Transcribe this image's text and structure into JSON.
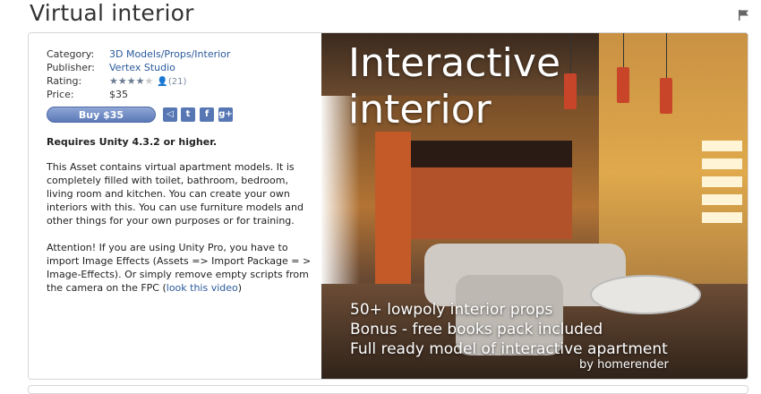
{
  "page": {
    "title": "Virtual interior"
  },
  "meta": {
    "category_label": "Category:",
    "category_value": "3D Models/Props/Interior",
    "publisher_label": "Publisher:",
    "publisher_value": "Vertex Studio",
    "rating_label": "Rating:",
    "rating_stars": 4,
    "rating_max": 5,
    "rating_count": "(21)",
    "price_label": "Price:",
    "price_value": "$35"
  },
  "actions": {
    "buy_label": "Buy $35",
    "share_icons": [
      "share-icon",
      "twitter-icon",
      "facebook-icon",
      "google-plus-icon"
    ]
  },
  "requirements": "Requires Unity 4.3.2 or higher.",
  "description": {
    "para1": "This Asset contains virtual apartment models. It is completely filled with toilet, bathroom, bedroom, living room and kitchen. You can create your own interiors with this. You can use furniture models and other things for your own purposes or for training.",
    "para2_text": "Attention! If you are using Unity Pro, you have to import Image Effects (Assets => Import Package = > Image-Effects). Or simply remove empty scripts from the camera on the FPC (",
    "para2_link": "look this video",
    "para2_end": ")"
  },
  "hero": {
    "title_line1": "Interactive",
    "title_line2": "interior",
    "line1": "50+ lowpoly interior props",
    "line2": "Bonus - free books pack included",
    "line3": "Full ready model of interactive apartment",
    "credit": "by homerender"
  },
  "colors": {
    "link": "#2b5a9c",
    "buy_button": "#6f8cc6",
    "star": "#6b7c93"
  }
}
